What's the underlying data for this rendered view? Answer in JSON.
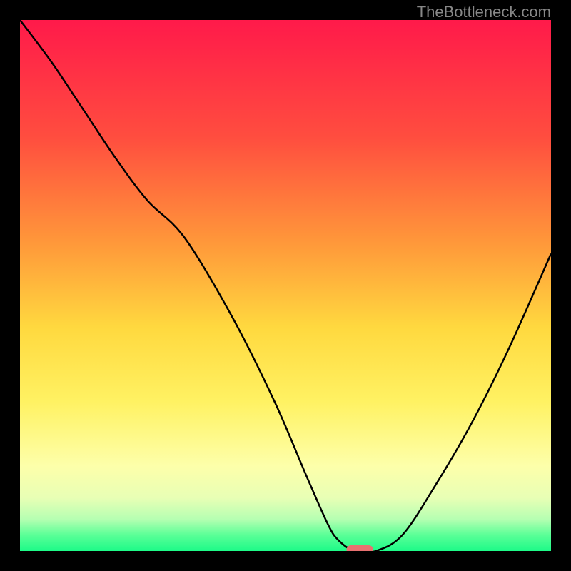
{
  "watermark": "TheBottleneck.com",
  "chart_data": {
    "type": "line",
    "title": "",
    "xlabel": "",
    "ylabel": "",
    "xlim": [
      0,
      100
    ],
    "ylim": [
      0,
      100
    ],
    "background_gradient_stops": [
      {
        "offset": 0,
        "color": "#ff1a4a"
      },
      {
        "offset": 22,
        "color": "#ff4d3f"
      },
      {
        "offset": 42,
        "color": "#ff983a"
      },
      {
        "offset": 58,
        "color": "#ffd93f"
      },
      {
        "offset": 72,
        "color": "#fff263"
      },
      {
        "offset": 84,
        "color": "#fdffaa"
      },
      {
        "offset": 90,
        "color": "#e8ffb5"
      },
      {
        "offset": 94,
        "color": "#b6ffb2"
      },
      {
        "offset": 97,
        "color": "#5aff97"
      },
      {
        "offset": 100,
        "color": "#1dfa88"
      }
    ],
    "series": [
      {
        "name": "bottleneck-curve",
        "x": [
          0,
          6,
          12,
          18,
          24,
          31,
          40,
          48,
          54,
          58,
          60,
          63,
          67,
          72,
          78,
          85,
          92,
          100
        ],
        "y": [
          100,
          92,
          83,
          74,
          66,
          59,
          44,
          28,
          14,
          5,
          2,
          0,
          0,
          3,
          12,
          24,
          38,
          56
        ]
      }
    ],
    "marker": {
      "name": "optimal-point",
      "x": 64,
      "y": 0,
      "width": 5,
      "color": "#e87070"
    }
  }
}
